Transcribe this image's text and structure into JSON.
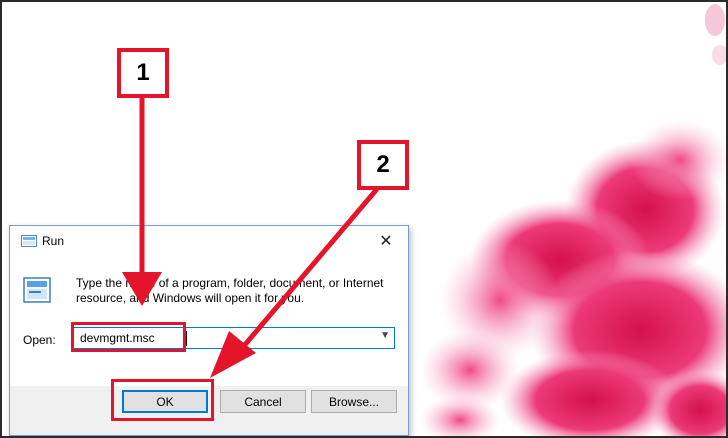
{
  "dialog": {
    "title": "Run",
    "description": "Type the name of a program, folder, document, or Internet resource, and Windows will open it for you.",
    "open_label": "Open:",
    "input_value": "devmgmt.msc",
    "buttons": {
      "ok": "OK",
      "cancel": "Cancel",
      "browse": "Browse..."
    }
  },
  "annotations": {
    "step_1": "1",
    "step_2": "2",
    "accent_color": "#e4152a"
  },
  "wallpaper": {
    "theme": "pink-ink-smoke",
    "color": "#e8195a"
  },
  "icons": {
    "title": "run-icon",
    "content": "run-icon",
    "close": "close-icon",
    "dropdown": "chevron-down-icon"
  }
}
